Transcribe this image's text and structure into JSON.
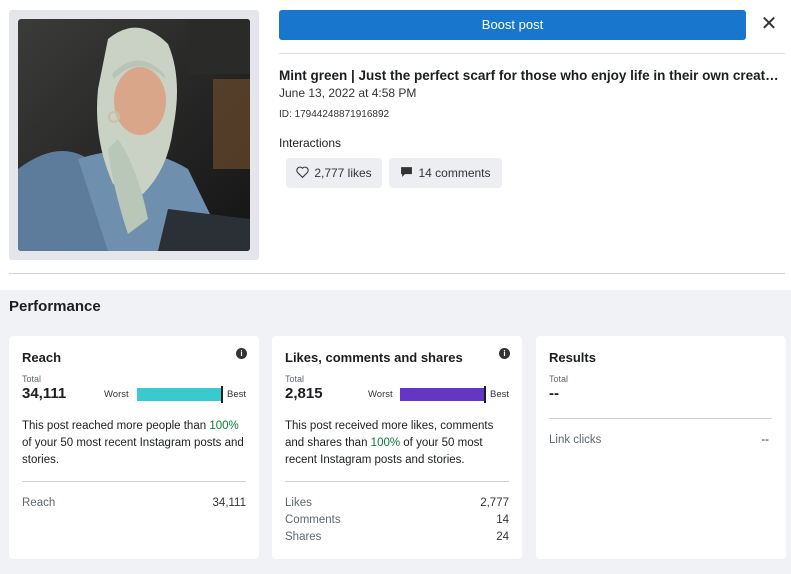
{
  "header": {
    "boost_label": "Boost post",
    "close_glyph": "✕"
  },
  "post": {
    "title": "Mint green | Just the perfect scarf for those who enjoy life in their own creati...",
    "date": "June 13, 2022 at 4:58 PM",
    "id_text": "ID: 17944248871916892",
    "interactions_label": "Interactions",
    "likes_label": "2,777 likes",
    "comments_label": "14 comments"
  },
  "performance": {
    "heading": "Performance",
    "reach": {
      "title": "Reach",
      "total_label": "Total",
      "total_value": "34,111",
      "worst_label": "Worst",
      "best_label": "Best",
      "bar_color": "#39c9cf",
      "bar_fill_fraction": 1.0,
      "desc_before": "This post reached more people than ",
      "desc_pct": "100%",
      "desc_after": " of your 50 most recent Instagram posts and stories.",
      "rows": [
        {
          "label": "Reach",
          "value": "34,111"
        }
      ]
    },
    "engagement": {
      "title": "Likes, comments and shares",
      "total_label": "Total",
      "total_value": "2,815",
      "worst_label": "Worst",
      "best_label": "Best",
      "bar_color": "#6337c4",
      "bar_fill_fraction": 1.0,
      "desc_before": "This post received more likes, comments and shares than ",
      "desc_pct": "100%",
      "desc_after": " of your 50 most recent Instagram posts and stories.",
      "rows": [
        {
          "label": "Likes",
          "value": "2,777"
        },
        {
          "label": "Comments",
          "value": "14"
        },
        {
          "label": "Shares",
          "value": "24"
        }
      ]
    },
    "results": {
      "title": "Results",
      "total_label": "Total",
      "total_value": "--",
      "rows": [
        {
          "label": "Link clicks",
          "value": "--"
        }
      ]
    }
  },
  "icons": [
    "heart-icon",
    "comment-icon",
    "info-icon",
    "close-icon"
  ]
}
